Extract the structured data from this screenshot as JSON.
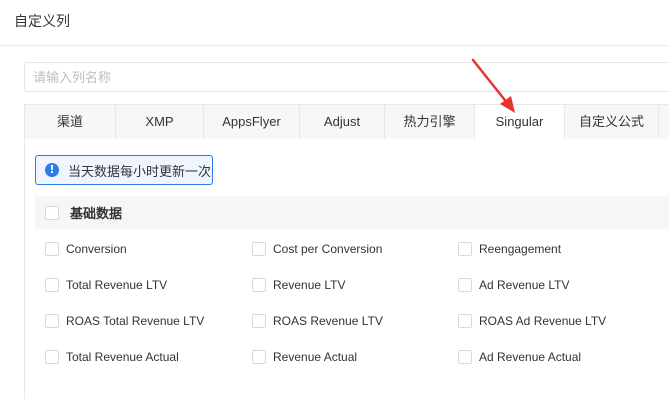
{
  "dialog": {
    "title": "自定义列"
  },
  "search": {
    "placeholder": "请输入列名称",
    "value": ""
  },
  "tabs": [
    {
      "label": "渠道",
      "active": false
    },
    {
      "label": "XMP",
      "active": false
    },
    {
      "label": "AppsFlyer",
      "active": false
    },
    {
      "label": "Adjust",
      "active": false
    },
    {
      "label": "热力引擎",
      "active": false
    },
    {
      "label": "Singular",
      "active": true
    },
    {
      "label": "自定义公式",
      "active": false
    }
  ],
  "notice": {
    "icon": "info-icon",
    "text": "当天数据每小时更新一次"
  },
  "section": {
    "title": "基础数据",
    "checked": false
  },
  "options": [
    [
      "Conversion",
      "Cost per Conversion",
      "Reengagement"
    ],
    [
      "Total Revenue LTV",
      "Revenue LTV",
      "Ad Revenue LTV"
    ],
    [
      "ROAS Total Revenue LTV",
      "ROAS Revenue LTV",
      "ROAS Ad Revenue LTV"
    ],
    [
      "Total Revenue Actual",
      "Revenue Actual",
      "Ad Revenue Actual"
    ]
  ],
  "colors": {
    "accent": "#2f7ae5",
    "annotation_arrow": "#e8342f"
  }
}
